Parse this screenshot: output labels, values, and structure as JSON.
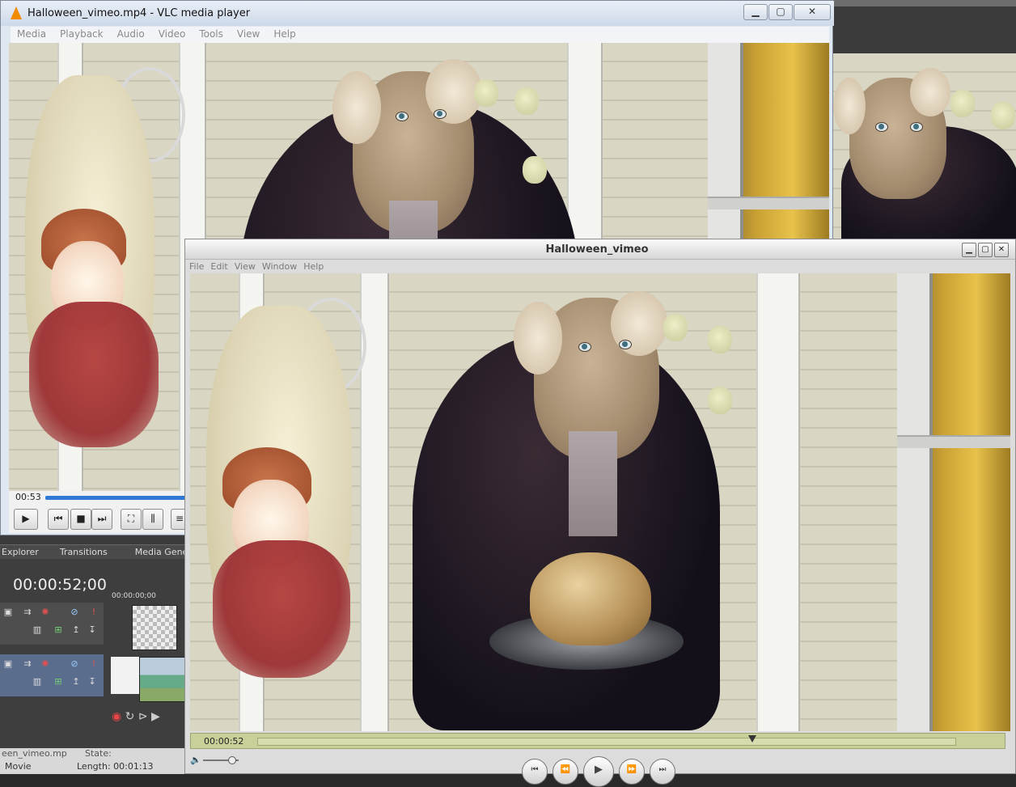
{
  "editor": {
    "tabs": [
      "Explorer",
      "Transitions",
      "Media Generators"
    ],
    "timecode": "00:00:52;00",
    "ruler_timecode": "00:00:00;00",
    "status": {
      "title_partial": "een_vimeo.mp",
      "state": "State:",
      "type": "Movie",
      "length_label": "Length:",
      "length_value": "00:01:13"
    }
  },
  "vlc": {
    "title": "Halloween_vimeo.mp4 - VLC media player",
    "menu": [
      "Media",
      "Playback",
      "Audio",
      "Video",
      "Tools",
      "View",
      "Help"
    ],
    "time": "00:53",
    "progress_fraction": 0.73,
    "icons": [
      "vlc-cone-icon",
      "minimize-icon",
      "maximize-icon",
      "close-icon",
      "play-icon",
      "previous-icon",
      "stop-icon",
      "next-icon",
      "fullscreen-icon",
      "extended-settings-icon",
      "playlist-icon"
    ]
  },
  "player": {
    "title": "Halloween_vimeo",
    "menu": [
      "File",
      "Edit",
      "View",
      "Window",
      "Help"
    ],
    "time": "00:00:52",
    "position_fraction": 0.71,
    "volume_fraction": 0.8,
    "icons": [
      "minimize-icon",
      "maximize-icon",
      "close-icon",
      "volume-icon",
      "go-to-start-icon",
      "rewind-icon",
      "play-icon",
      "fast-forward-icon",
      "go-to-end-icon"
    ]
  }
}
